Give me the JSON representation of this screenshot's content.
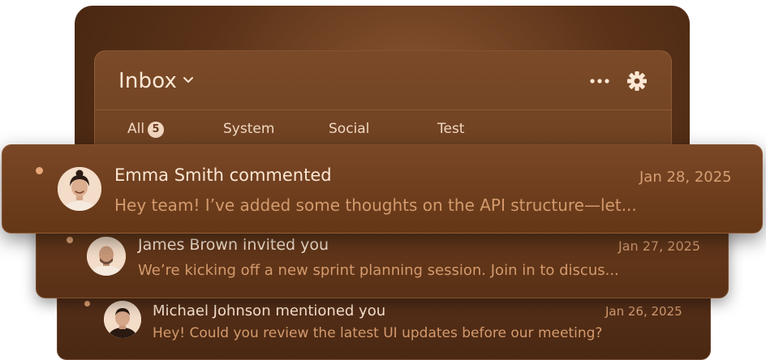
{
  "inbox": {
    "title": "Inbox",
    "tabs": [
      {
        "label": "All",
        "count": "5"
      },
      {
        "label": "System"
      },
      {
        "label": "Social"
      },
      {
        "label": "Test"
      }
    ]
  },
  "notifications": [
    {
      "title": "Emma Smith commented",
      "date": "Jan 28, 2025",
      "preview": "Hey team! I’ve added some thoughts on the API structure—let...",
      "unread": true
    },
    {
      "title": "James Brown invited you",
      "date": "Jan 27, 2025",
      "preview": "We’re kicking off a new sprint planning session. Join in to discus...",
      "unread": true
    },
    {
      "title": "Michael Johnson mentioned you",
      "date": "Jan 26, 2025",
      "preview": "Hey! Could you review the latest UI updates before our meeting?",
      "unread": true
    }
  ],
  "icons": {
    "dropdown": "chevron-down-icon",
    "more": "more-horizontal-icon",
    "settings": "gear-icon"
  },
  "colors": {
    "accent": "#e8a878",
    "text_primary": "#fbe7d4",
    "text_secondary": "#d49a6c"
  }
}
